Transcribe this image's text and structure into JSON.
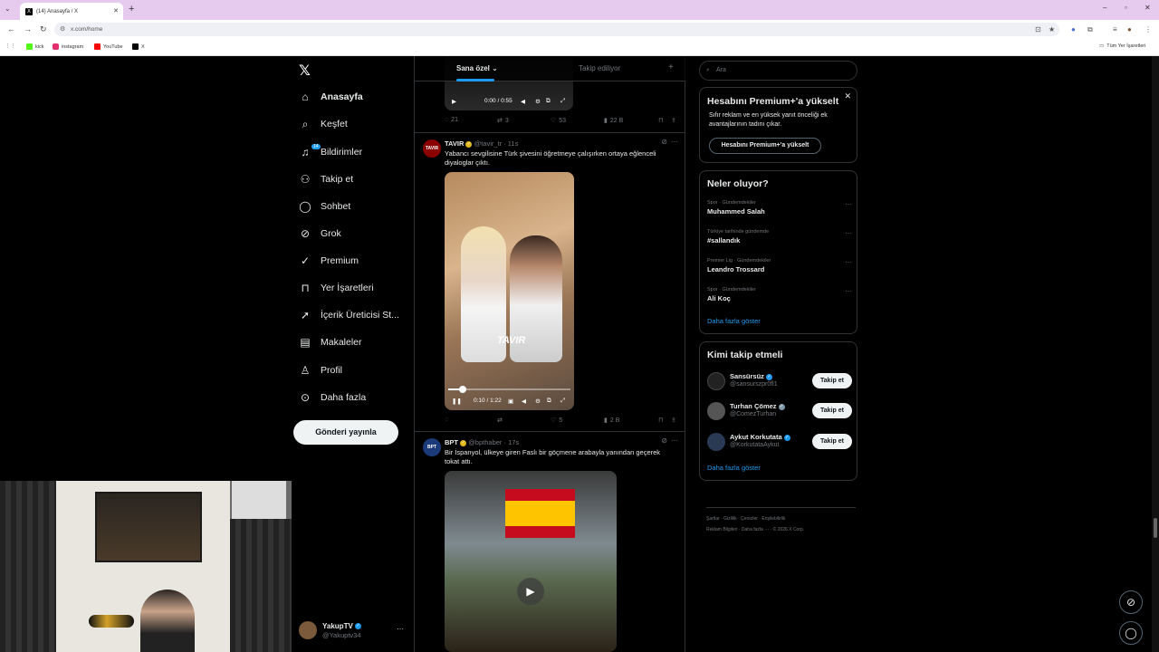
{
  "browser": {
    "tab_title": "(14) Anasayfa / X",
    "url": "x.com/home",
    "bookmarks": [
      {
        "label": "kick",
        "color": "#53fc18"
      },
      {
        "label": "instagram",
        "color": "#e1306c"
      },
      {
        "label": "YouTube",
        "color": "#ff0000"
      },
      {
        "label": "X",
        "color": "#000000"
      }
    ],
    "all_bookmarks": "Tüm Yer İşaretleri"
  },
  "nav": {
    "items": [
      {
        "label": "Anasayfa",
        "icon": "home-icon"
      },
      {
        "label": "Keşfet",
        "icon": "search-icon"
      },
      {
        "label": "Bildirimler",
        "icon": "bell-icon",
        "badge": "14"
      },
      {
        "label": "Takip et",
        "icon": "person-add-icon"
      },
      {
        "label": "Sohbet",
        "icon": "chat-icon"
      },
      {
        "label": "Grok",
        "icon": "grok-icon"
      },
      {
        "label": "Premium",
        "icon": "premium-icon"
      },
      {
        "label": "Yer İşaretleri",
        "icon": "bookmark-icon"
      },
      {
        "label": "İçerik Üreticisi St...",
        "icon": "rocket-icon"
      },
      {
        "label": "Makaleler",
        "icon": "article-icon"
      },
      {
        "label": "Profil",
        "icon": "profile-icon"
      },
      {
        "label": "Daha fazla",
        "icon": "more-icon"
      }
    ],
    "post_button": "Gönderi yayınla",
    "account": {
      "name": "YakupTV",
      "handle": "@Yakuptv34"
    }
  },
  "feed": {
    "tabs": [
      "Sana özel",
      "Takip ediliyor"
    ],
    "tweet0": {
      "time": "0:00 / 0:55",
      "replies": "21",
      "retweets": "3",
      "likes": "53",
      "views": "22 B"
    },
    "tweet1": {
      "name": "TAVIR",
      "handle": "@tavir_tr",
      "time": "· 11s",
      "avatar_text": "TAVIR",
      "text": "Yabancı sevgilisine Türk şivesini öğretmeye çalışırken ortaya eğlenceli diyaloglar çıktı.",
      "video_overlay": "TAVIR",
      "video_time": "0:10 / 1:22",
      "progress": 0.12,
      "replies": "",
      "retweets": "",
      "likes": "5",
      "views": "2 B"
    },
    "tweet2": {
      "name": "BPT",
      "handle": "@bpthaber",
      "time": "· 17s",
      "avatar_text": "BPT",
      "text": "Bir İspanyol, ülkeye giren Faslı bir göçmene arabayla yanından geçerek tokat attı."
    }
  },
  "right": {
    "search_placeholder": "Ara",
    "premium": {
      "title": "Hesabını Premium+'a yükselt",
      "text": "Sıfır reklam ve en yüksek yanıt önceliği ek avantajlarının tadını çıkar.",
      "button": "Hesabını Premium+'a yükselt"
    },
    "trends": {
      "title": "Neler oluyor?",
      "items": [
        {
          "category": "Spor · Gündemdekiler",
          "topic": "Muhammed Salah"
        },
        {
          "category": "Türkiye tarihinde gündemde",
          "topic": "#sallandık"
        },
        {
          "category": "Premier Lig · Gündemdekiler",
          "topic": "Leandro Trossard"
        },
        {
          "category": "Spor · Gündemdekiler",
          "topic": "Ali Koç"
        }
      ],
      "show_more": "Daha fazla göster"
    },
    "who": {
      "title": "Kimi takip etmeli",
      "items": [
        {
          "name": "Sansürsüz",
          "handle": "@sansurszpr0fl1",
          "button": "Takip et",
          "avatar": "#222222"
        },
        {
          "name": "Turhan Çömez",
          "handle": "@ComezTurhan",
          "button": "Takip et",
          "avatar": "#555555"
        },
        {
          "name": "Aykut Korkutata",
          "handle": "@KorkutataAykut",
          "button": "Takip et",
          "avatar": "#2a3a55"
        }
      ],
      "show_more": "Daha fazla göster"
    },
    "footer": {
      "line1": "Şartlar · Gizlilik · Çerezler · Erişilebilirlik",
      "line2": "Reklam Bilgileri · Daha fazla ··· · © 2026 X Corp."
    }
  }
}
